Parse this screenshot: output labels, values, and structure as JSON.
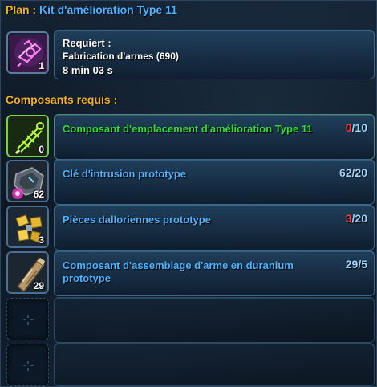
{
  "header": {
    "plan_label": "Plan :",
    "plan_name": "Kit d'amélioration Type 11"
  },
  "schematic": {
    "icon": "upgrade-kit-icon",
    "count": "1",
    "requires_label": "Requiert :",
    "skill": "Fabrication d'armes (690)",
    "time": "8 min 03 s"
  },
  "components_label": "Composants requis :",
  "components": [
    {
      "name": "Composant d'emplacement d'amélioration Type 11",
      "icon": "upgrade-slot-component-icon",
      "count": "0",
      "have": "0",
      "need": "10",
      "enough": false,
      "highlight": true
    },
    {
      "name": "Clé d'intrusion prototype",
      "icon": "intrusion-key-icon",
      "count": "62",
      "have": "62",
      "need": "20",
      "enough": true,
      "highlight": false
    },
    {
      "name": "Pièces dalloriennes prototype",
      "icon": "dallorian-parts-icon",
      "count": "3",
      "have": "3",
      "need": "20",
      "enough": false,
      "highlight": false
    },
    {
      "name": "Composant d'assemblage d'arme en duranium prototype",
      "icon": "duranium-assembly-icon",
      "count": "29",
      "have": "29",
      "need": "5",
      "enough": true,
      "highlight": false
    }
  ],
  "empty_slots": 2,
  "colors": {
    "accent_gold": "#f0b020",
    "accent_blue": "#4db2ff",
    "insufficient_red": "#ff3b3b",
    "highlight_green": "#33dd33"
  }
}
